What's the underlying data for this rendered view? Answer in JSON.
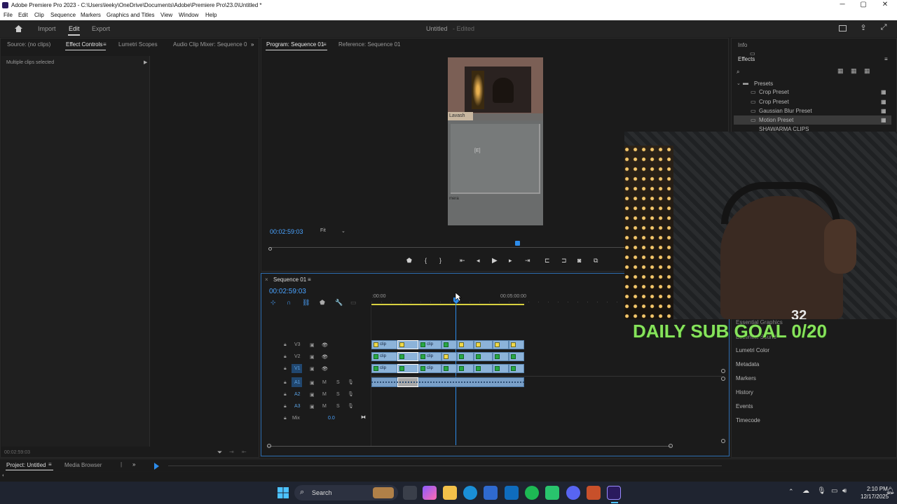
{
  "window": {
    "title": "Adobe Premiere Pro 2023 - C:\\Users\\leeky\\OneDrive\\Documents\\Adobe\\Premiere Pro\\23.0\\Untitled *",
    "min": "─",
    "max": "▢",
    "close": "✕"
  },
  "menu": [
    "File",
    "Edit",
    "Clip",
    "Sequence",
    "Markers",
    "Graphics and Titles",
    "View",
    "Window",
    "Help"
  ],
  "workspace": {
    "import": "Import",
    "edit": "Edit",
    "export": "Export",
    "project": "Untitled",
    "status": "- Edited"
  },
  "left_tabs": {
    "source": "Source: (no clips)",
    "effect_controls": "Effect Controls",
    "lumetri": "Lumetri Scopes",
    "audio_mixer": "Audio Clip Mixer: Sequence 0"
  },
  "effect_controls": {
    "message": "Multiple clips selected",
    "timecode": "00:02:59:03"
  },
  "program": {
    "tab": "Program: Sequence 01",
    "reference": "Reference: Sequence 01",
    "timecode": "00:02:59:03",
    "fit": "Fit",
    "overlay_label": "Lavash",
    "overlay_label2": "mera",
    "center_text": "[E]"
  },
  "timeline": {
    "tab": "Sequence 01",
    "timecode": "00:02:59:03",
    "ruler_start": ":00:00",
    "ruler_mid": "00:05:00:00",
    "tracks_video": [
      "V3",
      "V2",
      "V1"
    ],
    "tracks_audio": [
      "A1",
      "A2",
      "A3"
    ],
    "mix": "Mix",
    "mix_value": "0.0",
    "m": "M",
    "s": "S",
    "clip_label": "clip"
  },
  "right_panel": {
    "info": "Info",
    "effects": "Effects",
    "search_placeholder": "",
    "presets": "Presets",
    "items": [
      "Crop Preset",
      "Crop Preset",
      "Gaussian Blur Preset",
      "Motion Preset",
      "SHAWARMA CLIPS"
    ],
    "lower": [
      "Essential Graphics",
      "Essential Sound",
      "Lumetri Color",
      "Metadata",
      "Markers",
      "History",
      "Events",
      "Timecode"
    ]
  },
  "overlay": {
    "sub_goal": "DAILY SUB GOAL 0/20",
    "jersey": "32"
  },
  "bottom": {
    "project": "Project: Untitled",
    "media": "Media Browser"
  },
  "taskbar": {
    "search": "Search",
    "time": "2:10 PM",
    "date": "12/17/2025"
  },
  "colors": {
    "accent": "#2d8ceb",
    "timecode": "#4aa3ff",
    "subgoal": "#86e35b"
  }
}
